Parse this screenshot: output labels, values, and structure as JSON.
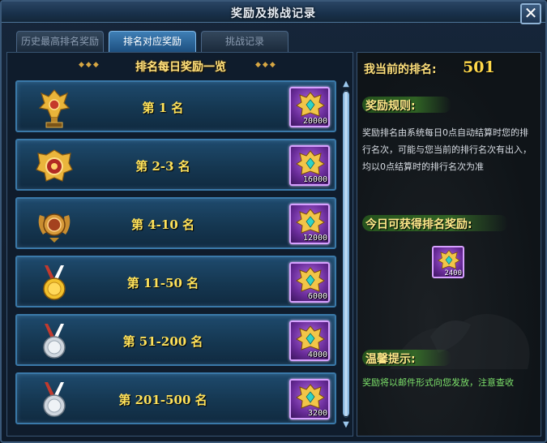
{
  "window": {
    "title": "奖励及挑战记录",
    "close_icon": "close-icon"
  },
  "tabs": [
    {
      "label": "历史最高排名奖励",
      "active": false
    },
    {
      "label": "排名对应奖励",
      "active": true
    },
    {
      "label": "挑战记录",
      "active": false
    }
  ],
  "list": {
    "header": "排名每日奖励一览",
    "rows": [
      {
        "label": "第 1 名",
        "medal_icon": "gold-trophy-icon",
        "reward_icon": "gold-crest-icon",
        "reward_count": "20000"
      },
      {
        "label": "第 2-3 名",
        "medal_icon": "gold-badge-icon",
        "reward_icon": "gold-crest-icon",
        "reward_count": "16000"
      },
      {
        "label": "第 4-10 名",
        "medal_icon": "bronze-badge-icon",
        "reward_icon": "gold-crest-icon",
        "reward_count": "12000"
      },
      {
        "label": "第 11-50 名",
        "medal_icon": "gold-medal-icon",
        "reward_icon": "gold-crest-icon",
        "reward_count": "6000"
      },
      {
        "label": "第 51-200 名",
        "medal_icon": "silver-medal-icon",
        "reward_icon": "gold-crest-icon",
        "reward_count": "4000"
      },
      {
        "label": "第 201-500 名",
        "medal_icon": "silver-medal-icon",
        "reward_icon": "gold-crest-icon",
        "reward_count": "3200"
      }
    ]
  },
  "side": {
    "my_rank_label": "我当前的排名:",
    "my_rank_value": "501",
    "rules_title": "奖励规则:",
    "rules_text": "奖励排名由系统每日0点自动结算时您的排行名次，可能与您当前的排行名次有出入，均以0点结算时的排行名次为准",
    "today_title": "今日可获得排名奖励:",
    "today_reward_count": "2400",
    "tip_title": "温馨提示:",
    "tip_text": "奖励将以邮件形式向您发放，注意查收"
  },
  "colors": {
    "accent_gold": "#ffe25a",
    "tab_active": "#2f6a9f",
    "reward_purple": "#6a2c9a",
    "tip_green": "#7de26b"
  }
}
